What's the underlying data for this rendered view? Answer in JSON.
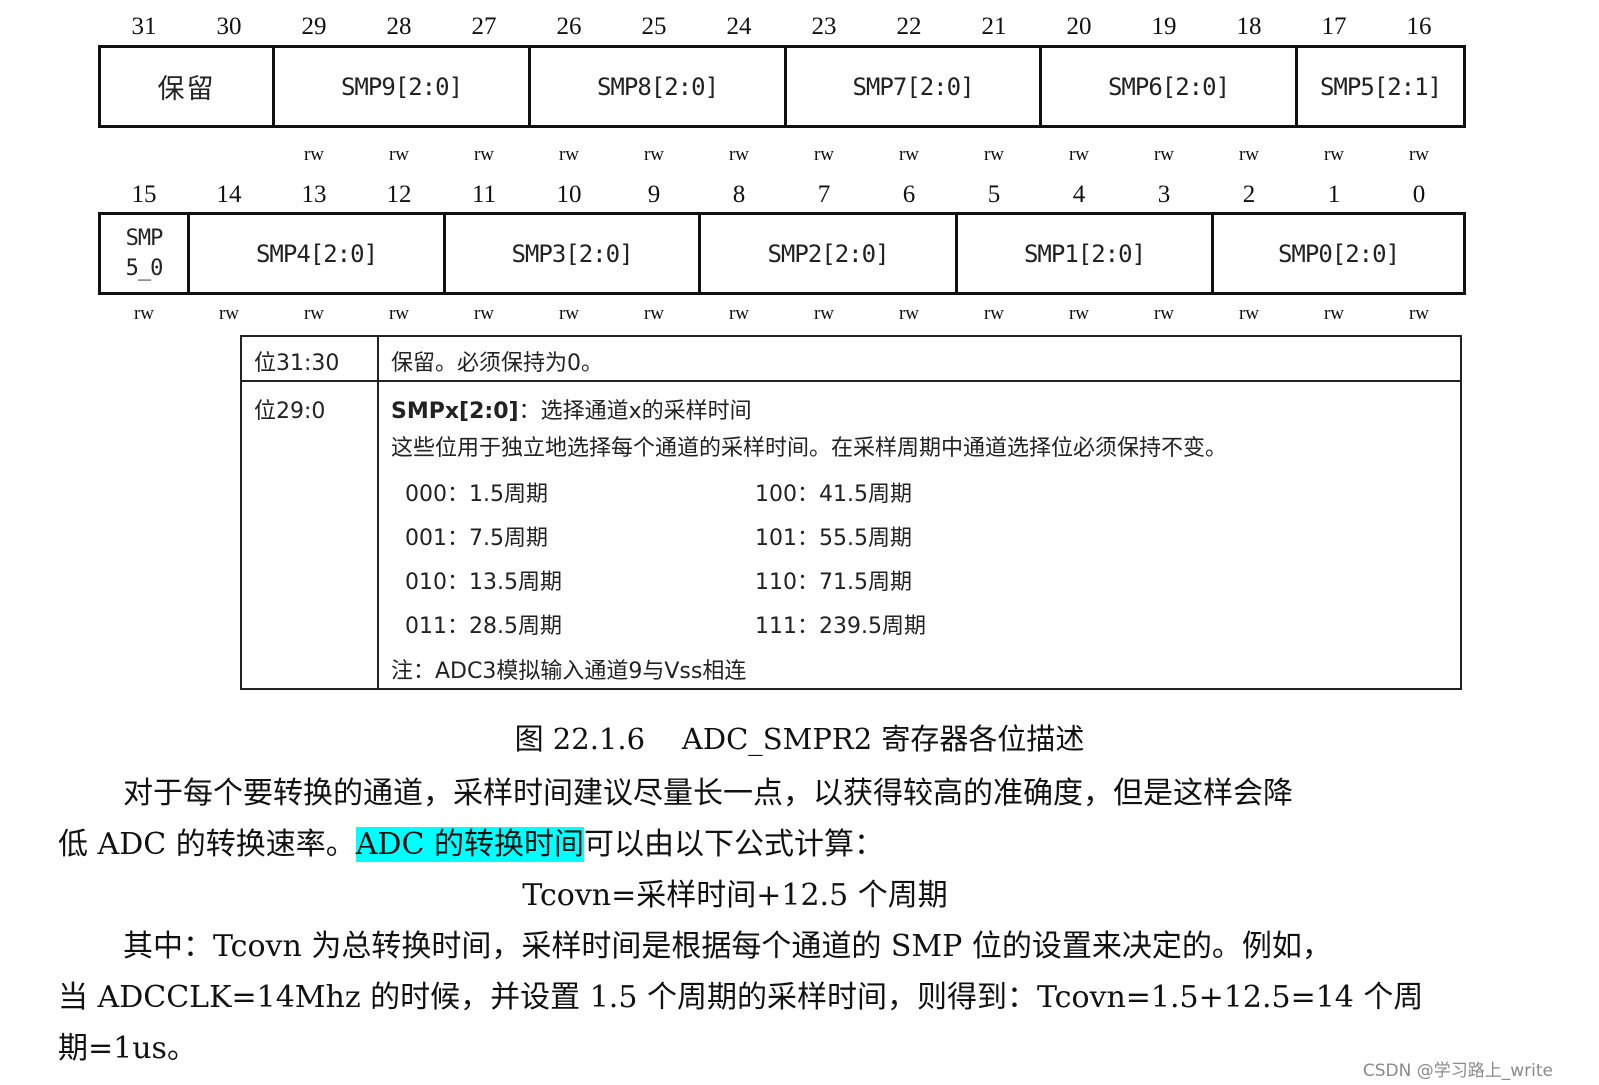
{
  "upper_register": {
    "bit_numbers": [
      "31",
      "30",
      "29",
      "28",
      "27",
      "26",
      "25",
      "24",
      "23",
      "22",
      "21",
      "20",
      "19",
      "18",
      "17",
      "16"
    ],
    "fields": [
      {
        "label": "保留"
      },
      {
        "label": "SMP9[2:0]"
      },
      {
        "label": "SMP8[2:0]"
      },
      {
        "label": "SMP7[2:0]"
      },
      {
        "label": "SMP6[2:0]"
      },
      {
        "label": "SMP5[2:1]"
      }
    ],
    "access": [
      "rw",
      "rw",
      "rw",
      "rw",
      "rw",
      "rw",
      "rw",
      "rw",
      "rw",
      "rw",
      "rw",
      "rw",
      "rw",
      "rw"
    ]
  },
  "lower_register": {
    "bit_numbers": [
      "15",
      "14",
      "13",
      "12",
      "11",
      "10",
      "9",
      "8",
      "7",
      "6",
      "5",
      "4",
      "3",
      "2",
      "1",
      "0"
    ],
    "fields": [
      {
        "label_line1": "SMP",
        "label_line2": "5_0"
      },
      {
        "label": "SMP4[2:0]"
      },
      {
        "label": "SMP3[2:0]"
      },
      {
        "label": "SMP2[2:0]"
      },
      {
        "label": "SMP1[2:0]"
      },
      {
        "label": "SMP0[2:0]"
      }
    ],
    "access": [
      "rw",
      "rw",
      "rw",
      "rw",
      "rw",
      "rw",
      "rw",
      "rw",
      "rw",
      "rw",
      "rw",
      "rw",
      "rw",
      "rw",
      "rw",
      "rw"
    ]
  },
  "description": {
    "row1": {
      "bits": "位31:30",
      "text": "保留。必须保持为0。"
    },
    "row2": {
      "bits": "位29:0",
      "title_bold": "SMPx[2:0]",
      "title_rest": "：选择通道x的采样时间",
      "line2": "这些位用于独立地选择每个通道的采样时间。在采样周期中通道选择位必须保持不变。",
      "options": [
        {
          "code": "000",
          "value": "1.5周期"
        },
        {
          "code": "001",
          "value": "7.5周期"
        },
        {
          "code": "010",
          "value": "13.5周期"
        },
        {
          "code": "011",
          "value": "28.5周期"
        },
        {
          "code": "100",
          "value": "41.5周期"
        },
        {
          "code": "101",
          "value": "55.5周期"
        },
        {
          "code": "110",
          "value": "71.5周期"
        },
        {
          "code": "111",
          "value": "239.5周期"
        }
      ],
      "note": "注：ADC3模拟输入通道9与Vss相连"
    }
  },
  "caption": "图 22.1.6    ADC_SMPR2 寄存器各位描述",
  "body": {
    "p1_line1": "对于每个要转换的通道，采样时间建议尽量长一点，以获得较高的准确度，但是这样会降",
    "p1_line2_before": "低 ADC 的转换速率。",
    "p1_line2_highlight": "ADC 的转换时间",
    "p1_line2_after": "可以由以下公式计算：",
    "formula": "Tcovn=采样时间+12.5 个周期",
    "p2_line1": "其中：Tcovn 为总转换时间，采样时间是根据每个通道的 SMP 位的设置来决定的。例如，",
    "p2_line2": "当 ADCCLK=14Mhz 的时候，并设置 1.5 个周期的采样时间，则得到：Tcovn=1.5+12.5=14 个周",
    "p2_line3": "期=1us。"
  },
  "watermark": "CSDN @学习路上_write",
  "colors": {
    "highlight": "#00ffff",
    "text": "#111111",
    "watermark": "#8a8a8a"
  }
}
